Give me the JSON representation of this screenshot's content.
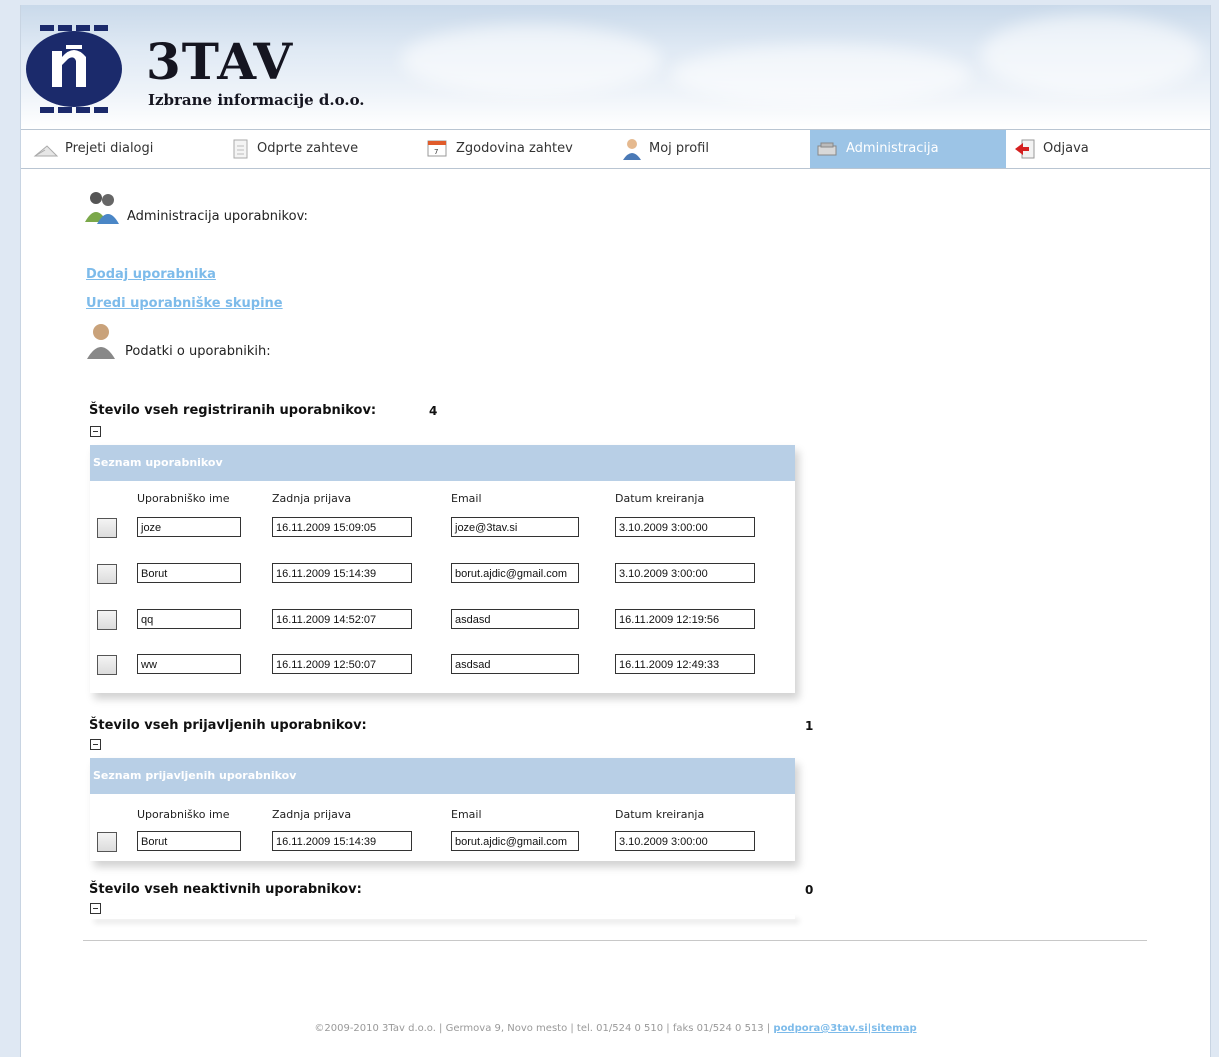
{
  "brand": {
    "name": "3TAV",
    "subtitle": "Izbrane informacije d.o.o."
  },
  "nav": [
    {
      "label": "Prejeti dialogi",
      "icon": "envelope-icon"
    },
    {
      "label": "Odprte zahteve",
      "icon": "document-icon"
    },
    {
      "label": "Zgodovina zahtev",
      "icon": "calendar-icon"
    },
    {
      "label": "Moj profil",
      "icon": "user-icon"
    },
    {
      "label": "Administracija",
      "icon": "admin-icon",
      "active": true
    },
    {
      "label": "Odjava",
      "icon": "logout-icon"
    }
  ],
  "admin_heading": "Administracija uporabnikov:",
  "links": {
    "add_user": "Dodaj uporabnika",
    "edit_groups": "Uredi uporabniške skupine"
  },
  "info_heading": "Podatki o uporabnikih:",
  "columns": [
    "Uporabniško ime",
    "Zadnja prijava",
    "Email",
    "Datum kreiranja"
  ],
  "registered": {
    "label": "Število vseh registriranih uporabnikov:",
    "count": "4",
    "panel_title": "Seznam uporabnikov",
    "rows": [
      {
        "username": "joze",
        "last_login": "16.11.2009 15:09:05",
        "email": "joze@3tav.si",
        "created": "3.10.2009 3:00:00"
      },
      {
        "username": "Borut",
        "last_login": "16.11.2009 15:14:39",
        "email": "borut.ajdic@gmail.com",
        "created": "3.10.2009 3:00:00"
      },
      {
        "username": "qq",
        "last_login": "16.11.2009 14:52:07",
        "email": "asdasd",
        "created": "16.11.2009 12:19:56"
      },
      {
        "username": "ww",
        "last_login": "16.11.2009 12:50:07",
        "email": "asdsad",
        "created": "16.11.2009 12:49:33"
      }
    ]
  },
  "logged_in": {
    "label": "Število vseh prijavljenih uporabnikov:",
    "count": "1",
    "panel_title": "Seznam prijavljenih uporabnikov",
    "rows": [
      {
        "username": "Borut",
        "last_login": "16.11.2009 15:14:39",
        "email": "borut.ajdic@gmail.com",
        "created": "3.10.2009 3:00:00"
      }
    ]
  },
  "inactive": {
    "label": "Število vseh neaktivnih uporabnikov:",
    "count": "0"
  },
  "footer": {
    "text": "©2009-2010 3Tav d.o.o. | Germova 9, Novo mesto | tel. 01/524 0 510 | faks 01/524 0 513 |",
    "email": "podpora@3tav.si",
    "sep": "|",
    "sitemap": "sitemap"
  },
  "colors": {
    "active_tab": "#9cc4e6",
    "panel_header": "#b8cfe6",
    "link": "#7dbbea"
  }
}
